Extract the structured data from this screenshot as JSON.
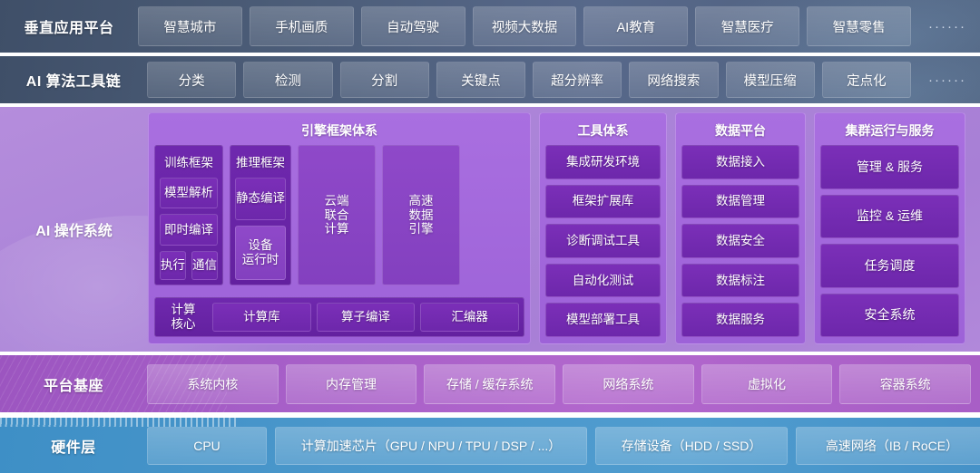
{
  "rows": {
    "vertical": {
      "label": "垂直应用平台",
      "chips": [
        "智慧城市",
        "手机画质",
        "自动驾驶",
        "视频大数据",
        "AI教育",
        "智慧医疗",
        "智慧零售"
      ],
      "ellipsis": "······"
    },
    "algo": {
      "label": "AI 算法工具链",
      "chips": [
        "分类",
        "检测",
        "分割",
        "关键点",
        "超分辨率",
        "网络搜索",
        "模型压缩",
        "定点化"
      ],
      "ellipsis": "······"
    },
    "os": {
      "label": "AI 操作系统",
      "panels": [
        {
          "title": "引擎框架体系",
          "columns": [
            {
              "title": "训练框架",
              "boxes": [
                "模型解析",
                "即时编译"
              ],
              "pair": [
                "执行",
                "通信"
              ]
            },
            {
              "title": "推理框架",
              "boxes": [
                "静态编译",
                "设备\n运行时"
              ]
            }
          ],
          "tall": [
            "云端\n联合\n计算",
            "高速\n数据\n引擎"
          ],
          "bottom_label": "计算\n核心",
          "bottom_boxes": [
            "计算库",
            "算子编译",
            "汇编器"
          ]
        },
        {
          "title": "工具体系",
          "boxes": [
            "集成研发环境",
            "框架扩展库",
            "诊断调试工具",
            "自动化测试",
            "模型部署工具"
          ]
        },
        {
          "title": "数据平台",
          "boxes": [
            "数据接入",
            "数据管理",
            "数据安全",
            "数据标注",
            "数据服务"
          ]
        },
        {
          "title": "集群运行与服务",
          "boxes": [
            "管理 & 服务",
            "监控 & 运维",
            "任务调度",
            "安全系统"
          ]
        }
      ]
    },
    "base": {
      "label": "平台基座",
      "chips": [
        "系统内核",
        "内存管理",
        "存储 / 缓存系统",
        "网络系统",
        "虚拟化",
        "容器系统"
      ]
    },
    "hardware": {
      "label": "硬件层",
      "chips": [
        "CPU",
        "计算加速芯片（GPU / NPU / TPU / DSP / ...）",
        "存储设备（HDD / SSD）",
        "高速网络（IB / RoCE）"
      ]
    }
  },
  "colors": {
    "slate": "#4b5c77",
    "os_purple": "#ab84d8",
    "panel_purple": "#9d62d8",
    "box_purple": "#6d27ab",
    "base_purple": "#a75fc8",
    "hardware_blue": "#4a97cb",
    "text": "#ffffff"
  }
}
